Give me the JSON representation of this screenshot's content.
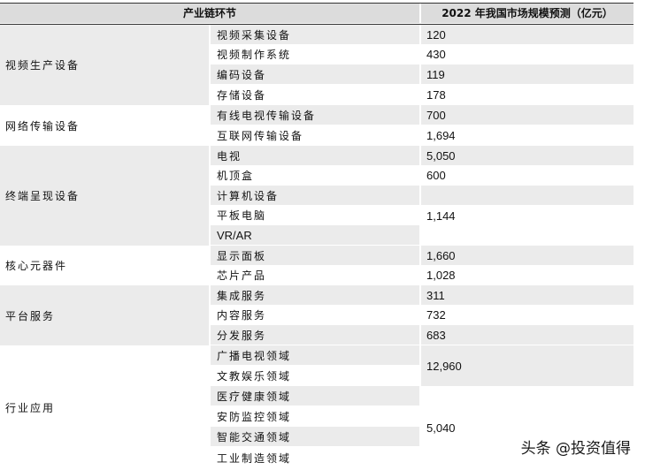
{
  "header": {
    "col1": "产业链环节",
    "col2": "2022 年我国市场规模预测（亿元）"
  },
  "categories": [
    {
      "label": "视频生产设备"
    },
    {
      "label": "网络传输设备"
    },
    {
      "label": "终端呈现设备"
    },
    {
      "label": "核心元器件"
    },
    {
      "label": "平台服务"
    },
    {
      "label": "行业应用"
    }
  ],
  "subs": [
    "视频采集设备",
    "视频制作系统",
    "编码设备",
    "存储设备",
    "有线电视传输设备",
    "互联网传输设备",
    "电视",
    "机顶盒",
    "计算机设备",
    "平板电脑",
    "VR/AR",
    "显示面板",
    "芯片产品",
    "集成服务",
    "内容服务",
    "分发服务",
    "广播电视领域",
    "文教娱乐领域",
    "医疗健康领域",
    "安防监控领域",
    "智能交通领域",
    "工业制造领域"
  ],
  "values": [
    "120",
    "430",
    "119",
    "178",
    "700",
    "1,694",
    "5,050",
    "600",
    "1,144",
    "1,660",
    "1,028",
    "311",
    "732",
    "683",
    "12,960",
    "5,040"
  ],
  "watermark": "头条 @投资值得"
}
